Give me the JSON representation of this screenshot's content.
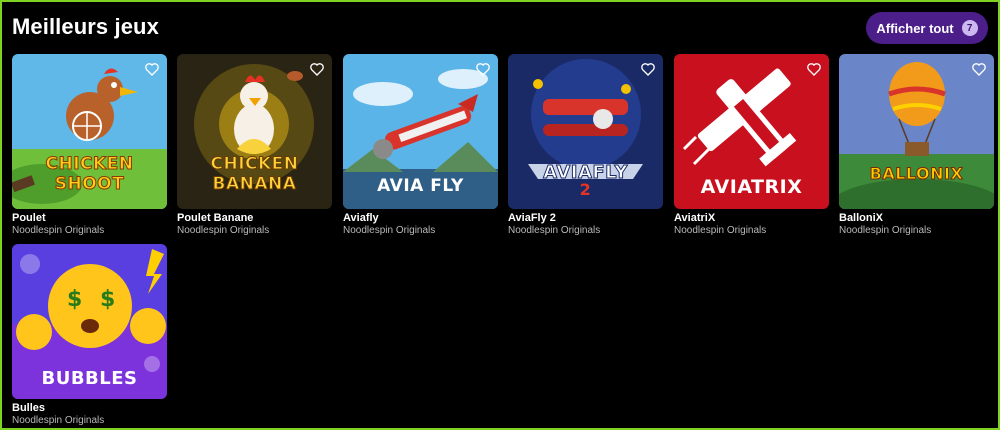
{
  "section": {
    "title": "Meilleurs jeux",
    "show_all_label": "Afficher tout",
    "show_all_count": "7"
  },
  "games": [
    {
      "name": "Poulet",
      "provider": "Noodlespin Originals",
      "art_text_1": "CHICKEN",
      "art_text_2": "SHOOT",
      "accent": "#f2c200"
    },
    {
      "name": "Poulet Banane",
      "provider": "Noodlespin Originals",
      "art_text_1": "CHICKEN",
      "art_text_2": "BANANA",
      "accent": "#ffd23a"
    },
    {
      "name": "Aviafly",
      "provider": "Noodlespin Originals",
      "art_text_1": "AVIA FLY",
      "accent": "#d9342b"
    },
    {
      "name": "AviaFly 2",
      "provider": "Noodlespin Originals",
      "art_text_1": "AVIAFLY",
      "art_text_2": "2",
      "accent": "#2a3f8a"
    },
    {
      "name": "AviatriX",
      "provider": "Noodlespin Originals",
      "art_text_1": "AVIATRIX",
      "accent": "#c8101e"
    },
    {
      "name": "BalloniX",
      "provider": "Noodlespin Originals",
      "art_text_1": "BALLONIX",
      "accent": "#ffd000"
    },
    {
      "name": "Bulles",
      "provider": "Noodlespin Originals",
      "art_text_1": "BUBBLES",
      "accent": "#7a3ff0"
    }
  ]
}
